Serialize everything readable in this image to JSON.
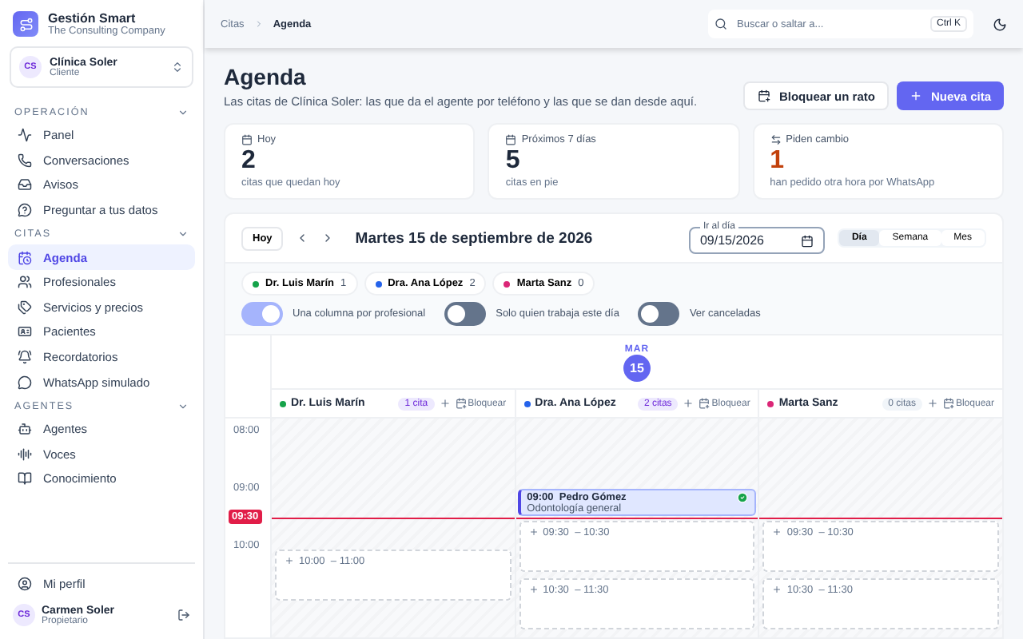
{
  "brand": {
    "name": "Gestión Smart",
    "subtitle": "The Consulting Company"
  },
  "workspace": {
    "initials": "CS",
    "name": "Clínica Soler",
    "role": "Cliente"
  },
  "sidebar": {
    "sections": [
      {
        "title": "OPERACIÓN",
        "expanded": true,
        "items": [
          {
            "label": "Panel",
            "selected": false
          },
          {
            "label": "Conversaciones",
            "selected": false
          },
          {
            "label": "Avisos",
            "selected": false
          },
          {
            "label": "Preguntar a tus datos",
            "selected": false
          }
        ]
      },
      {
        "title": "CITAS",
        "expanded": true,
        "items": [
          {
            "label": "Agenda",
            "selected": true
          },
          {
            "label": "Profesionales",
            "selected": false
          },
          {
            "label": "Servicios y precios",
            "selected": false
          },
          {
            "label": "Pacientes",
            "selected": false
          },
          {
            "label": "Recordatorios",
            "selected": false
          },
          {
            "label": "WhatsApp simulado",
            "selected": false
          }
        ]
      },
      {
        "title": "AGENTES",
        "expanded": true,
        "items": [
          {
            "label": "Agentes",
            "selected": false
          },
          {
            "label": "Voces",
            "selected": false
          },
          {
            "label": "Conocimiento",
            "selected": false
          }
        ]
      }
    ],
    "footer": {
      "profile": "Mi perfil",
      "user": {
        "initials": "CS",
        "name": "Carmen Soler",
        "role": "Propietario"
      }
    }
  },
  "breadcrumb": [
    "Citas",
    "Agenda"
  ],
  "search": {
    "placeholder": "Buscar o saltar a...",
    "shortcut": "Ctrl K"
  },
  "page": {
    "title": "Agenda",
    "description": "Las citas de Clínica Soler: las que da el agente por teléfono y las que se dan desde aquí.",
    "buttons": [
      {
        "label": "Bloquear un rato",
        "kind": "secondary"
      },
      {
        "label": "Nueva cita",
        "kind": "primary"
      }
    ]
  },
  "stats": [
    {
      "label": "Hoy",
      "value": "2",
      "note": "citas que quedan hoy",
      "kind": "normal"
    },
    {
      "label": "Próximos 7 días",
      "value": "5",
      "note": "citas en pie",
      "kind": "normal"
    },
    {
      "label": "Piden cambio",
      "value": "1",
      "note": "han pedido otra hora por WhatsApp",
      "kind": "warning"
    }
  ],
  "calendar": {
    "today_button": "Hoy",
    "date_title": "Martes 15 de septiembre de 2026",
    "date_field": {
      "label": "Ir al día",
      "value": "09/15/2026"
    },
    "views": [
      {
        "label": "Día",
        "selected": true
      },
      {
        "label": "Semana",
        "selected": false
      },
      {
        "label": "Mes",
        "selected": false
      }
    ],
    "filters": [
      {
        "name": "Dr. Luis Marín",
        "count": "1",
        "color": "#16a34a"
      },
      {
        "name": "Dra. Ana López",
        "count": "2",
        "color": "#2563eb"
      },
      {
        "name": "Marta Sanz",
        "count": "0",
        "color": "#db2777"
      }
    ],
    "toggles": [
      {
        "label": "Una columna por profesional",
        "on": true
      },
      {
        "label": "Solo quien trabaja este día",
        "on": false
      },
      {
        "label": "Ver canceladas",
        "on": false
      }
    ],
    "day": {
      "weekday": "MAR",
      "number": "15"
    },
    "hours": [
      "08:00",
      "09:00",
      "10:00"
    ],
    "now": "09:30",
    "columns": [
      {
        "name": "Dr. Luis Marín",
        "color": "#16a34a",
        "count": "1 cita",
        "has_citas": true,
        "block_label": "Bloquear",
        "slots": [
          {
            "start": "10:00",
            "end": "– 11:00"
          }
        ]
      },
      {
        "name": "Dra. Ana López",
        "color": "#2563eb",
        "count": "2 citas",
        "has_citas": true,
        "block_label": "Bloquear",
        "events": [
          {
            "time": "09:00",
            "patient": "Pedro Gómez",
            "service": "Odontología general",
            "confirmed": true
          }
        ],
        "slots": [
          {
            "start": "09:30",
            "end": "– 10:30"
          },
          {
            "start": "10:30",
            "end": "– 11:30"
          }
        ]
      },
      {
        "name": "Marta Sanz",
        "color": "#db2777",
        "count": "0 citas",
        "has_citas": false,
        "block_label": "Bloquear",
        "slots": [
          {
            "start": "09:30",
            "end": "– 10:30"
          },
          {
            "start": "10:30",
            "end": "– 11:30"
          }
        ]
      }
    ]
  }
}
